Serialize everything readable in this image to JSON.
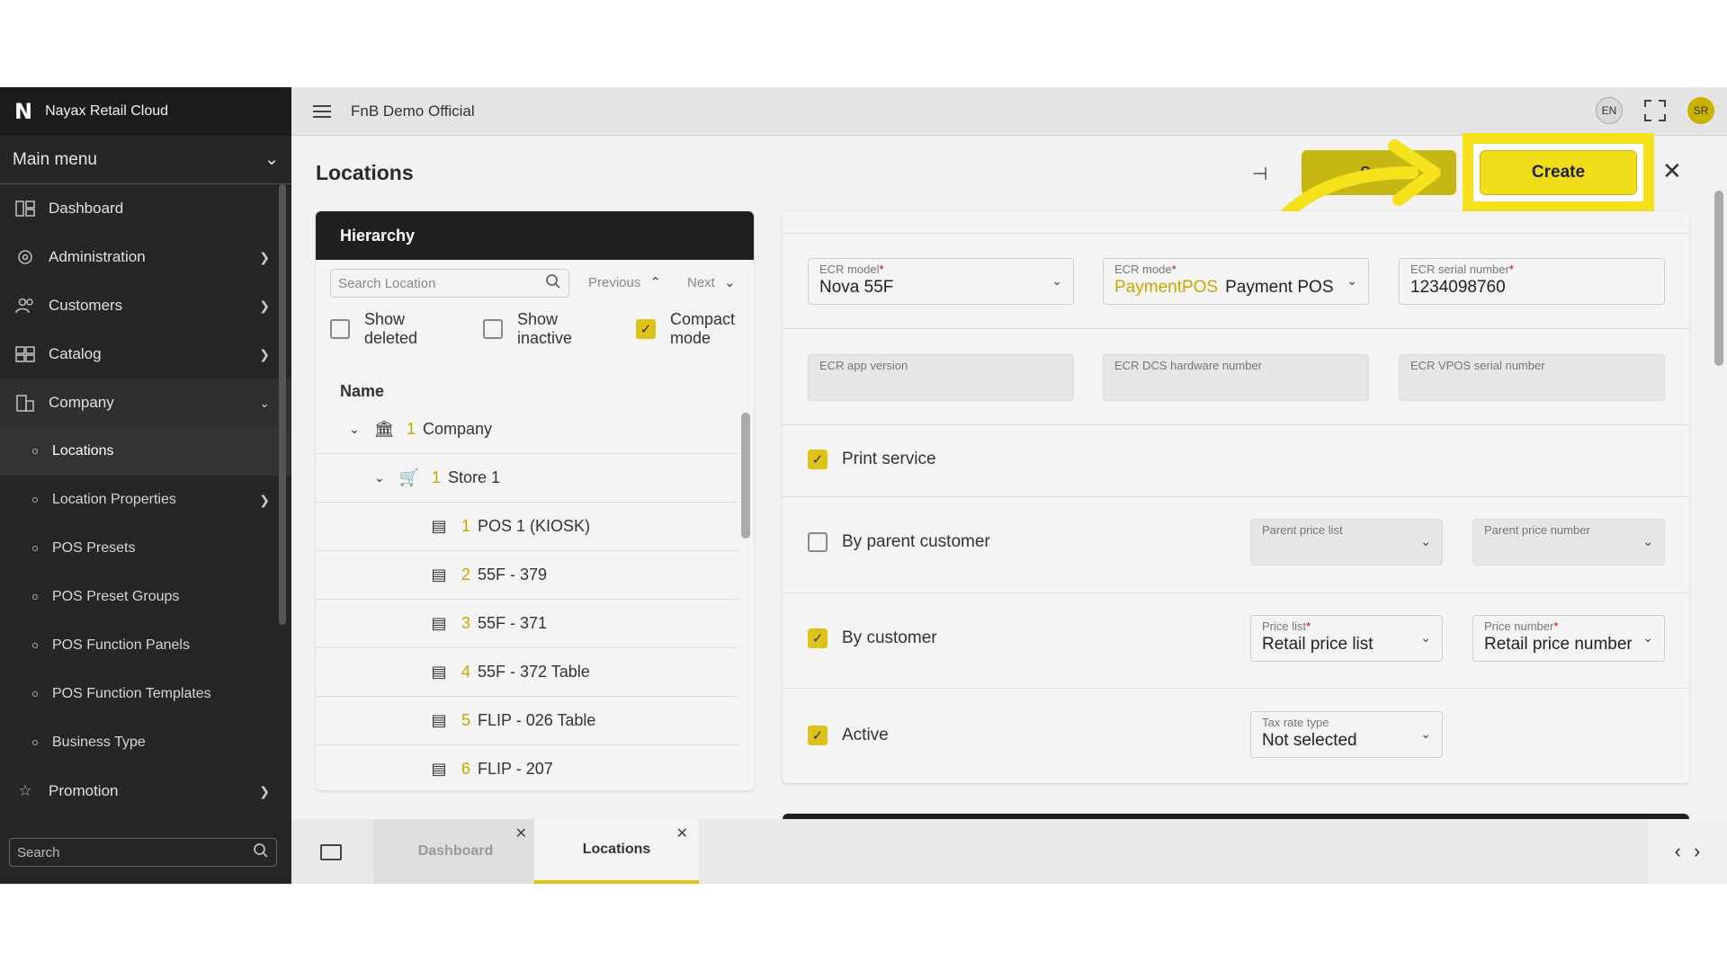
{
  "brand": {
    "logo": "N",
    "name": "Nayax Retail Cloud"
  },
  "sidebar": {
    "main_menu": "Main menu",
    "items": [
      {
        "label": "Dashboard"
      },
      {
        "label": "Administration"
      },
      {
        "label": "Customers"
      },
      {
        "label": "Catalog"
      },
      {
        "label": "Company"
      }
    ],
    "sub_items": [
      {
        "label": "Locations"
      },
      {
        "label": "Location Properties"
      },
      {
        "label": "POS Presets"
      },
      {
        "label": "POS Preset Groups"
      },
      {
        "label": "POS Function Panels"
      },
      {
        "label": "POS Function Templates"
      },
      {
        "label": "Business Type"
      }
    ],
    "promotion": "Promotion",
    "search_placeholder": "Search"
  },
  "header": {
    "org_name": "FnB Demo Official",
    "lang": "EN",
    "avatar": "SR"
  },
  "page": {
    "title": "Locations",
    "ghost_button": "Save",
    "create_button": "Create"
  },
  "hierarchy": {
    "title": "Hierarchy",
    "search_placeholder": "Search Location",
    "previous": "Previous",
    "next": "Next",
    "show_deleted": "Show deleted",
    "show_inactive": "Show inactive",
    "compact_mode": "Compact mode",
    "column_name": "Name",
    "rows": [
      {
        "num": "1",
        "label": "Company"
      },
      {
        "num": "1",
        "label": "Store 1"
      },
      {
        "num": "1",
        "label": "POS 1 (KIOSK)"
      },
      {
        "num": "2",
        "label": "55F - 379"
      },
      {
        "num": "3",
        "label": "55F - 371"
      },
      {
        "num": "4",
        "label": "55F - 372 Table"
      },
      {
        "num": "5",
        "label": "FLIP - 026 Table"
      },
      {
        "num": "6",
        "label": "FLIP - 207"
      }
    ]
  },
  "form": {
    "ecr_model": {
      "label": "ECR model",
      "value": "Nova 55F"
    },
    "ecr_mode": {
      "label": "ECR mode",
      "highlight": "PaymentPOS",
      "value": "Payment POS"
    },
    "ecr_serial": {
      "label": "ECR serial number",
      "value": "1234098760"
    },
    "ecr_app_version": {
      "label": "ECR app version"
    },
    "ecr_dcs": {
      "label": "ECR DCS hardware number"
    },
    "ecr_vpos": {
      "label": "ECR VPOS serial number"
    },
    "print_service": "Print service",
    "by_parent_customer": "By parent customer",
    "parent_price_list": "Parent price list",
    "parent_price_number": "Parent price number",
    "by_customer": "By customer",
    "price_list": {
      "label": "Price list",
      "value": "Retail price list"
    },
    "price_number": {
      "label": "Price number",
      "value": "Retail price number"
    },
    "active": "Active",
    "tax_rate_type": {
      "label": "Tax rate type",
      "value": "Not selected"
    }
  },
  "bottom_tabs": [
    {
      "label": "Dashboard"
    },
    {
      "label": "Locations"
    }
  ],
  "colors": {
    "accent": "#f0de1a",
    "highlight_box": "#f5e11c",
    "sidebar": "#262626"
  }
}
